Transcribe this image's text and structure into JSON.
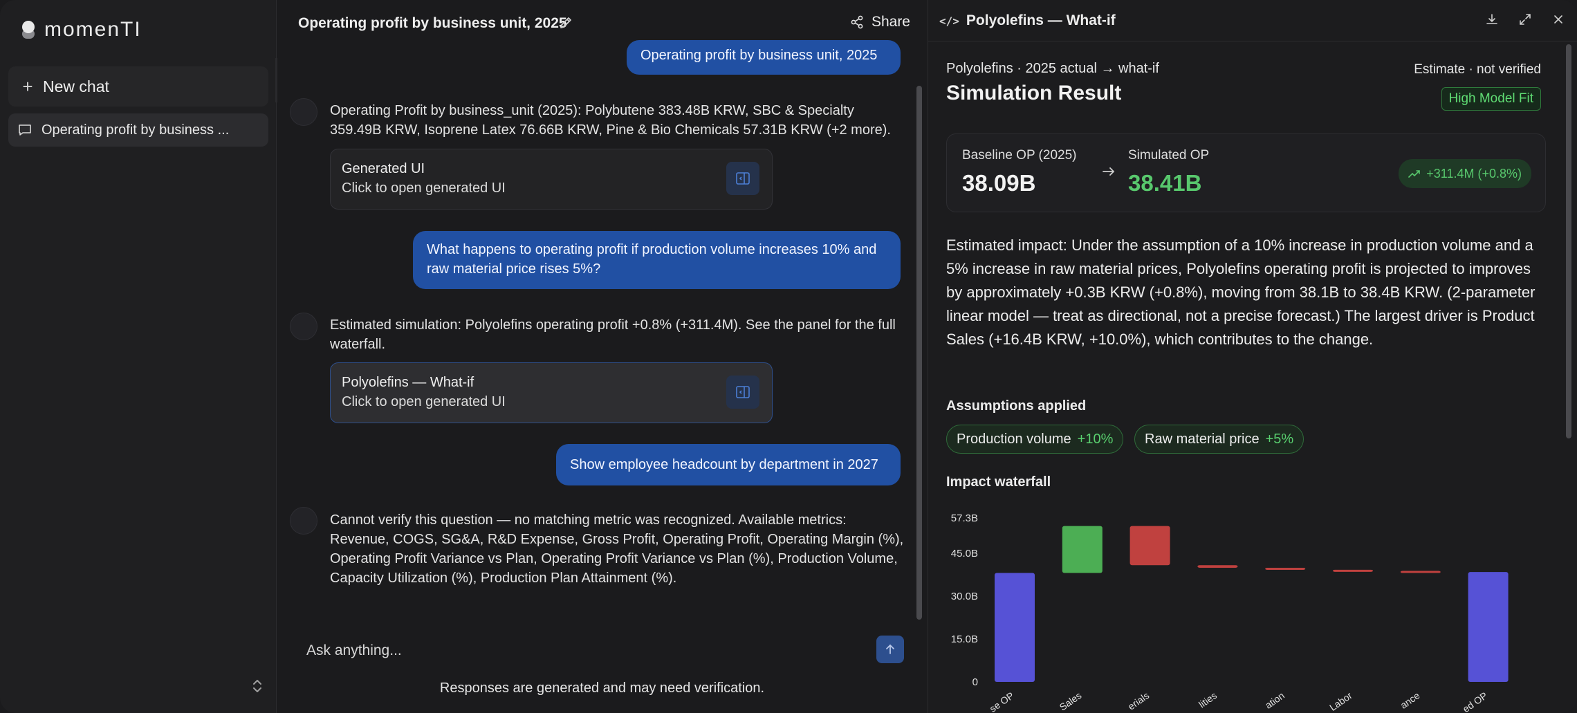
{
  "sidebar": {
    "brand": "momenTI",
    "new_chat_label": "New chat",
    "chat_items": [
      {
        "label": "Operating profit by business ..."
      }
    ]
  },
  "chat": {
    "title": "Operating profit by business unit, 2025",
    "share_label": "Share",
    "messages": [
      {
        "role": "user",
        "text": "Operating profit by business unit, 2025"
      },
      {
        "role": "assistant",
        "text": "Operating Profit by business_unit (2025): Polybutene 383.48B KRW, SBC & Specialty 359.49B KRW, Isoprene Latex 76.66B KRW, Pine & Bio Chemicals 57.31B KRW (+2 more).",
        "card": {
          "title": "Generated UI",
          "subtitle": "Click to open generated UI"
        }
      },
      {
        "role": "user",
        "text": "What happens to operating profit if production volume increases 10% and raw material price rises 5%?"
      },
      {
        "role": "assistant",
        "text": "Estimated simulation: Polyolefins operating profit +0.8% (+311.4M). See the panel for the full waterfall.",
        "card": {
          "title": "Polyolefins — What-if",
          "subtitle": "Click to open generated UI"
        }
      },
      {
        "role": "user",
        "text": "Show employee headcount by department in 2027"
      },
      {
        "role": "assistant",
        "text": "Cannot verify this question — no matching metric was recognized. Available metrics: Revenue, COGS, SG&A, R&D Expense, Gross Profit, Operating Profit, Operating Margin (%), Operating Profit Variance vs Plan, Operating Profit Variance vs Plan (%), Production Volume, Capacity Utilization (%), Production Plan Attainment (%)."
      }
    ],
    "composer_placeholder": "Ask anything...",
    "disclaimer": "Responses are generated and may need verification."
  },
  "panel": {
    "title": "Polyolefins — What-if",
    "kicker": "Polyolefins · 2025 actual → what-if",
    "heading": "Simulation Result",
    "estimate_label": "Estimate · not verified",
    "fit_badge": "High Model Fit",
    "baseline_label": "Baseline OP (2025)",
    "baseline_value": "38.09B",
    "simulated_label": "Simulated OP",
    "simulated_value": "38.41B",
    "delta_badge": "+311.4M (+0.8%)",
    "impact_text": "Estimated impact: Under the assumption of a 10% increase in production volume and a 5% increase in raw material prices, Polyolefins operating profit is projected to improves by approximately +0.3B KRW (+0.8%), moving from 38.1B to 38.4B KRW. (2-parameter linear model — treat as directional, not a precise forecast.) The largest driver is Product Sales (+16.4B KRW, +10.0%), which contributes to the change.",
    "assumptions_title": "Assumptions applied",
    "assumptions": [
      {
        "label": "Production volume",
        "value": "+10%"
      },
      {
        "label": "Raw material price",
        "value": "+5%"
      }
    ],
    "waterfall_title": "Impact waterfall",
    "colors": {
      "base": "#5652d6",
      "increase": "#4cae54",
      "decrease": "#c0413f",
      "accent": "#2150a3"
    }
  },
  "chart_data": {
    "type": "bar",
    "yticks": [
      "57.3B",
      "45.0B",
      "30.0B",
      "15.0B",
      "0"
    ],
    "ylim": [
      0,
      57.3
    ],
    "categories": [
      "se OP",
      "Sales",
      "erials",
      "lities",
      "ation",
      "Labor",
      "ance",
      "ed OP"
    ],
    "bars": [
      {
        "kind": "total",
        "start": 0,
        "end": 38.09
      },
      {
        "kind": "increase",
        "start": 38.09,
        "end": 54.5
      },
      {
        "kind": "decrease",
        "start": 54.5,
        "end": 40.8
      },
      {
        "kind": "decrease",
        "start": 40.8,
        "end": 39.9
      },
      {
        "kind": "decrease",
        "start": 39.9,
        "end": 39.2
      },
      {
        "kind": "decrease",
        "start": 39.2,
        "end": 38.8
      },
      {
        "kind": "decrease",
        "start": 38.8,
        "end": 38.41
      },
      {
        "kind": "total",
        "start": 0,
        "end": 38.41
      }
    ]
  }
}
